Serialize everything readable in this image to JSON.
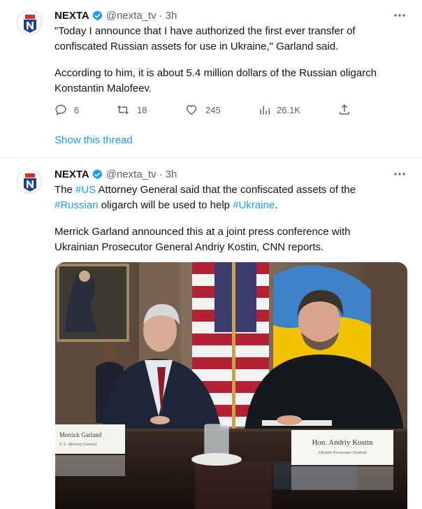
{
  "tweets": [
    {
      "author": "NEXTA",
      "handle": "@nexta_tv",
      "dot": "·",
      "time": "3h",
      "text_lines": [
        "\"Today I announce that I have authorized the first ever transfer of",
        "confiscated Russian assets for use in Ukraine,\" Garland said."
      ],
      "text2_lines": [
        "According to him, it is about 5.4 million dollars of the Russian oligarch",
        "Konstantin Malofeev."
      ],
      "replies": "6",
      "retweets": "18",
      "likes": "245",
      "views": "26.1K",
      "show_thread": "Show this thread"
    },
    {
      "author": "NEXTA",
      "handle": "@nexta_tv",
      "dot": "·",
      "time": "3h",
      "line1": {
        "a": "The ",
        "tag1": "#US",
        "b": " Attorney General said that the confiscated assets of the"
      },
      "line2": {
        "tag1": "#Russian",
        "a": " oligarch will be used to help ",
        "tag2": "#Ukraine",
        "b": "."
      },
      "text2_lines": [
        "Merrick Garland announced this at a joint press conference with",
        "Ukrainian Prosecutor General Andriy Kostin, CNN reports."
      ],
      "photo": {
        "placard_left_name": "Merrick Garland",
        "placard_left_title": "U.S. Attorney General",
        "placard_right_name": "Hon. Andriy Kostin",
        "placard_right_title": "Ukraine Prosecutor General"
      }
    }
  ],
  "colors": {
    "accent": "#1d9bf0",
    "secondary_text": "#536471",
    "brand_red": "#d0312d",
    "brand_navy": "#1c3f8e"
  },
  "icons": [
    "nexta-logo-icon",
    "verified-badge-icon",
    "more-options-icon",
    "reply-icon",
    "retweet-icon",
    "like-icon",
    "views-icon",
    "share-icon"
  ]
}
